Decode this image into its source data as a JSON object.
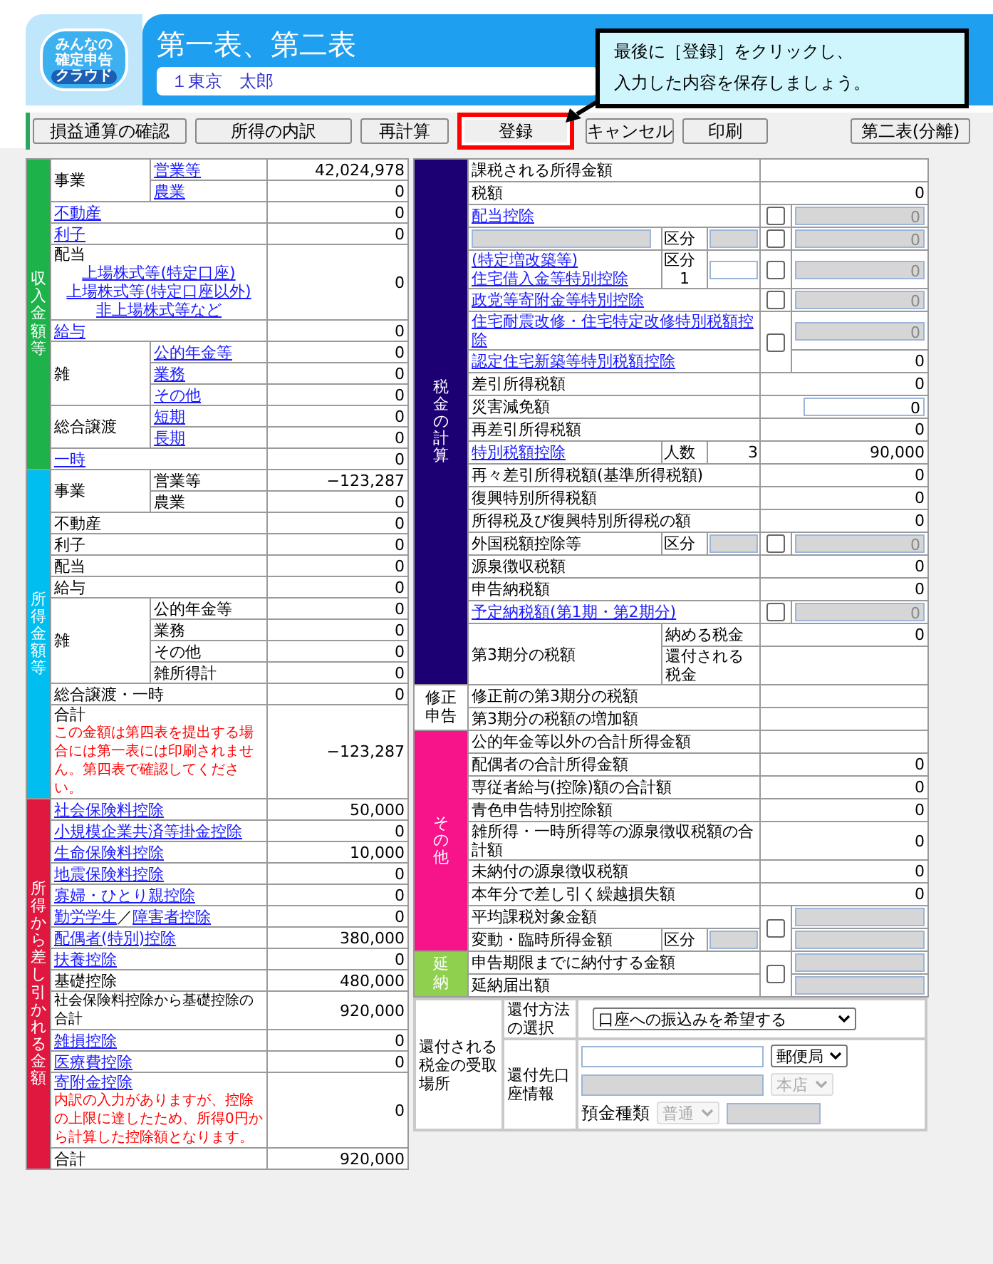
{
  "header": {
    "logo": [
      "みんなの",
      "確定申告",
      "クラウド"
    ],
    "title": "第一表、第二表",
    "user": "１東京　太郎"
  },
  "callout": {
    "lines": [
      "最後に［登録］をクリックし、",
      "入力した内容を保存しましょう。"
    ]
  },
  "toolbar": [
    {
      "label": "損益通算の確認",
      "highlighted": false
    },
    {
      "label": "所得の内訳",
      "highlighted": false
    },
    {
      "label": "再計算",
      "highlighted": false
    },
    {
      "label": "登録",
      "highlighted": true
    },
    {
      "label": "キャンセル",
      "highlighted": false
    },
    {
      "label": "印刷",
      "highlighted": false
    },
    {
      "label": "第二表(分離)",
      "highlighted": false
    }
  ],
  "income_panel": {
    "sections": [
      {
        "label": "収入金額等",
        "color": "#1db34a",
        "rows": [
          {
            "label": "事業",
            "link": false,
            "sub": [
              {
                "label": "営業等",
                "link": true,
                "value": "42,024,978"
              },
              {
                "label": "農業",
                "link": true,
                "value": "0"
              }
            ]
          },
          {
            "label": "不動産",
            "link": true,
            "value": "0"
          },
          {
            "label": "利子",
            "link": true,
            "value": "0"
          },
          {
            "label": "配当",
            "link": false,
            "links": [
              "上場株式等(特定口座)",
              "上場株式等(特定口座以外)",
              "非上場株式等など"
            ],
            "value": "0"
          },
          {
            "label": "給与",
            "link": true,
            "value": "0"
          },
          {
            "label": "雑",
            "link": false,
            "sub": [
              {
                "label": "公的年金等",
                "link": true,
                "value": "0"
              },
              {
                "label": "業務",
                "link": true,
                "value": "0"
              },
              {
                "label": "その他",
                "link": true,
                "value": "0"
              }
            ]
          },
          {
            "label": "総合譲渡",
            "link": false,
            "sub": [
              {
                "label": "短期",
                "link": true,
                "value": "0"
              },
              {
                "label": "長期",
                "link": true,
                "value": "0"
              }
            ]
          },
          {
            "label": "一時",
            "link": true,
            "value": "0"
          }
        ]
      },
      {
        "label": "所得金額等",
        "color": "#00bff0",
        "rows": [
          {
            "label": "事業",
            "link": false,
            "sub": [
              {
                "label": "営業等",
                "link": false,
                "value": "−123,287"
              },
              {
                "label": "農業",
                "link": false,
                "value": "0"
              }
            ]
          },
          {
            "label": "不動産",
            "link": false,
            "value": "0"
          },
          {
            "label": "利子",
            "link": false,
            "value": "0"
          },
          {
            "label": "配当",
            "link": false,
            "value": "0"
          },
          {
            "label": "給与",
            "link": false,
            "value": "0"
          },
          {
            "label": "雑",
            "link": false,
            "sub": [
              {
                "label": "公的年金等",
                "link": false,
                "value": "0"
              },
              {
                "label": "業務",
                "link": false,
                "value": "0"
              },
              {
                "label": "その他",
                "link": false,
                "value": "0"
              },
              {
                "label": "雑所得計",
                "link": false,
                "value": "0"
              }
            ]
          },
          {
            "label": "総合譲渡・一時",
            "link": false,
            "value": "0"
          },
          {
            "label": "合計",
            "link": false,
            "note": "この金額は第四表を提出する場合には第一表には印刷されません。第四表で確認してください。",
            "value": "−123,287"
          }
        ]
      },
      {
        "label": "所得から差し引かれる金額",
        "color": "#e0183f",
        "rows": [
          {
            "label": "社会保険料控除",
            "link": true,
            "value": "50,000"
          },
          {
            "label": "小規模企業共済等掛金控除",
            "link": true,
            "value": "0"
          },
          {
            "label": "生命保険料控除",
            "link": true,
            "value": "10,000"
          },
          {
            "label": "地震保険料控除",
            "link": true,
            "value": "0"
          },
          {
            "label": "寡婦・ひとり親控除",
            "link": true,
            "value": "0"
          },
          {
            "label": "勤労学生",
            "link": true,
            "sep": "／",
            "label2": "障害者控除",
            "value": "0"
          },
          {
            "label": "配偶者(特別)控除",
            "link": true,
            "value": "380,000"
          },
          {
            "label": "扶養控除",
            "link": true,
            "value": "0"
          },
          {
            "label": "基礎控除",
            "link": false,
            "value": "480,000"
          },
          {
            "label": "社会保険料控除から基礎控除の合計",
            "link": false,
            "small": true,
            "value": "920,000"
          },
          {
            "label": "雑損控除",
            "link": true,
            "value": "0"
          },
          {
            "label": "医療費控除",
            "link": true,
            "value": "0"
          },
          {
            "label": "寄附金控除",
            "link": true,
            "note": "内訳の入力がありますが、控除の上限に達したため、所得0円から計算した控除額となります。",
            "value": "0"
          },
          {
            "label": "合計",
            "link": false,
            "value": "920,000"
          }
        ]
      }
    ]
  },
  "tax_panel": {
    "sections": [
      {
        "label": "税金の計算",
        "color": "#1c0073",
        "rows": [
          {
            "label": "課税される所得金額",
            "link": false
          },
          {
            "label": "税額",
            "link": false,
            "value": "0"
          },
          {
            "label": "配当控除",
            "link": true,
            "check": {
              "checked": false
            },
            "input": {
              "value": "0",
              "disabled": true
            }
          },
          {
            "label_input": {
              "disabled": true
            },
            "mid": {
              "label": "区分",
              "input": {
                "disabled": true
              }
            },
            "check": {
              "checked": false
            },
            "input": {
              "value": "0",
              "disabled": true
            }
          },
          {
            "label": "(特定増改築等)\n住宅借入金等特別控除",
            "link": true,
            "mid": {
              "label": "区分",
              "note": "1",
              "input": {
                "disabled": false
              }
            },
            "check": {
              "checked": false
            },
            "input": {
              "value": "0",
              "disabled": true
            }
          },
          {
            "label": "政党等寄附金等特別控除",
            "link": true,
            "check": {
              "checked": false
            },
            "input": {
              "value": "0",
              "disabled": true
            }
          },
          {
            "label": "住宅耐震改修・住宅特定改修特別税額控除",
            "link": true,
            "check": {
              "checked": false
            },
            "input": {
              "value": "0",
              "disabled": true
            }
          },
          {
            "label": "認定住宅新築等特別税額控除",
            "link": true,
            "check_shared": true,
            "value": "0"
          },
          {
            "label": "差引所得税額",
            "link": false,
            "value": "0"
          },
          {
            "label": "災害減免額",
            "link": false,
            "input": {
              "value": "0",
              "disabled": false
            }
          },
          {
            "label": "再差引所得税額",
            "link": false,
            "value": "0"
          },
          {
            "label": "特別税額控除",
            "link": true,
            "mid": {
              "label": "人数",
              "value": "3"
            },
            "value": "90,000"
          },
          {
            "label": "再々差引所得税額(基準所得税額)",
            "link": false,
            "value": "0"
          },
          {
            "label": "復興特別所得税額",
            "link": false,
            "value": "0"
          },
          {
            "label": "所得税及び復興特別所得税の額",
            "link": false,
            "value": "0"
          },
          {
            "label": "外国税額控除等",
            "link": false,
            "mid": {
              "label": "区分",
              "input": {
                "disabled": true
              }
            },
            "check": {
              "checked": false
            },
            "input": {
              "value": "0",
              "disabled": true
            }
          },
          {
            "label": "源泉徴収税額",
            "link": false,
            "value": "0"
          },
          {
            "label": "申告納税額",
            "link": false,
            "value": "0"
          },
          {
            "label": "予定納税額(第1期・第2期分)",
            "link": true,
            "check": {
              "checked": false
            },
            "input": {
              "value": "0",
              "disabled": true
            }
          },
          {
            "label": "第3期分の税額",
            "link": false,
            "sub": [
              {
                "label": "納める税金",
                "value": "0"
              },
              {
                "label": "還付される税金"
              }
            ]
          }
        ]
      },
      {
        "label": "修正申告",
        "color": "#ffffff",
        "rows": [
          {
            "label": "修正前の第3期分の税額",
            "link": false
          },
          {
            "label": "第3期分の税額の増加額",
            "link": false
          }
        ]
      },
      {
        "label": "その他",
        "color": "#f7148b",
        "rows": [
          {
            "label": "公的年金等以外の合計所得金額",
            "link": false
          },
          {
            "label": "配偶者の合計所得金額",
            "link": false,
            "value": "0"
          },
          {
            "label": "専従者給与(控除)額の合計額",
            "link": false,
            "value": "0"
          },
          {
            "label": "青色申告特別控除額",
            "link": false,
            "value": "0"
          },
          {
            "label": "雑所得・一時所得等の源泉徴収税額の合計額",
            "link": false,
            "value": "0"
          },
          {
            "label": "未納付の源泉徴収税額",
            "link": false,
            "value": "0"
          },
          {
            "label": "本年分で差し引く繰越損失額",
            "link": false,
            "value": "0"
          },
          {
            "label": "平均課税対象金額",
            "link": false,
            "check": {
              "checked": false
            },
            "input": {
              "disabled": true
            }
          },
          {
            "label": "変動・臨時所得金額",
            "link": false,
            "mid": {
              "label": "区分",
              "input": {
                "disabled": true
              }
            },
            "check_shared": true,
            "input": {
              "disabled": true
            }
          }
        ]
      },
      {
        "label": "延納",
        "color": "#8fd14f",
        "rows": [
          {
            "label": "申告期限までに納付する金額",
            "link": false,
            "check": {
              "checked": false
            },
            "input": {
              "disabled": true
            }
          },
          {
            "label": "延納届出額",
            "link": false,
            "check_shared": true,
            "input": {
              "disabled": true
            }
          }
        ]
      }
    ]
  },
  "refund": {
    "label": "還付される税金の受取場所",
    "rows": [
      {
        "label": "還付方法の選択",
        "lines": [
          [
            {
              "kind": "select",
              "value": "口座への振込みを希望する",
              "disabled": false
            }
          ]
        ]
      },
      {
        "label": "還付先口座情報",
        "lines": [
          [
            {
              "kind": "input",
              "disabled": false
            },
            {
              "kind": "select",
              "value": "郵便局",
              "disabled": false
            }
          ],
          [
            {
              "kind": "input",
              "disabled": true
            },
            {
              "kind": "select",
              "value": "本店",
              "disabled": true
            }
          ],
          [
            {
              "kind": "text",
              "value": "預金種類"
            },
            {
              "kind": "select",
              "value": "普通",
              "disabled": true
            },
            {
              "kind": "input",
              "disabled": true
            }
          ]
        ]
      }
    ]
  }
}
